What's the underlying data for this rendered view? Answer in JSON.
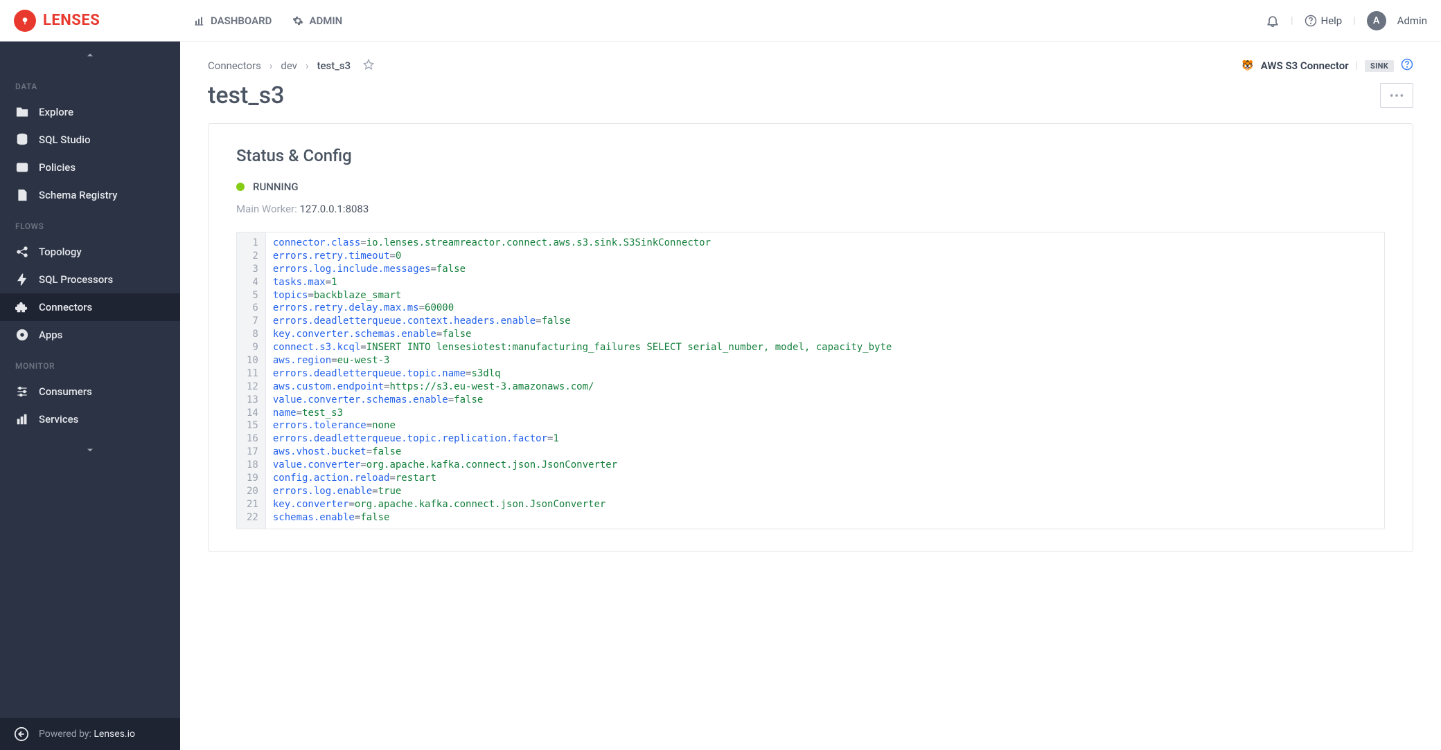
{
  "brand": {
    "name": "LENSES"
  },
  "topnav": {
    "dashboard": "DASHBOARD",
    "admin": "ADMIN"
  },
  "topbar": {
    "help": "Help",
    "user_initial": "A",
    "user_name": "Admin"
  },
  "sidebar": {
    "sections": [
      {
        "title": "DATA",
        "items": [
          {
            "id": "explore",
            "label": "Explore",
            "icon": "folder"
          },
          {
            "id": "sql-studio",
            "label": "SQL Studio",
            "icon": "database"
          },
          {
            "id": "policies",
            "label": "Policies",
            "icon": "id-card"
          },
          {
            "id": "schema-registry",
            "label": "Schema Registry",
            "icon": "file-text"
          }
        ]
      },
      {
        "title": "FLOWS",
        "items": [
          {
            "id": "topology",
            "label": "Topology",
            "icon": "share"
          },
          {
            "id": "sql-processors",
            "label": "SQL Processors",
            "icon": "bolt"
          },
          {
            "id": "connectors",
            "label": "Connectors",
            "icon": "puzzle",
            "active": true
          },
          {
            "id": "apps",
            "label": "Apps",
            "icon": "record"
          }
        ]
      },
      {
        "title": "MONITOR",
        "items": [
          {
            "id": "consumers",
            "label": "Consumers",
            "icon": "sliders"
          },
          {
            "id": "services",
            "label": "Services",
            "icon": "chart"
          }
        ]
      }
    ],
    "footer": {
      "prefix": "Powered by: ",
      "link": "Lenses.io"
    }
  },
  "breadcrumb": {
    "items": [
      "Connectors",
      "dev",
      "test_s3"
    ]
  },
  "connector_info": {
    "name": "AWS S3 Connector",
    "badge": "SINK"
  },
  "page": {
    "title": "test_s3",
    "section_title": "Status & Config",
    "status": "RUNNING",
    "worker_label": "Main Worker",
    "worker_value": "127.0.0.1:8083"
  },
  "config": [
    {
      "key": "connector.class",
      "value": "io.lenses.streamreactor.connect.aws.s3.sink.S3SinkConnector"
    },
    {
      "key": "errors.retry.timeout",
      "value": "0"
    },
    {
      "key": "errors.log.include.messages",
      "value": "false"
    },
    {
      "key": "tasks.max",
      "value": "1"
    },
    {
      "key": "topics",
      "value": "backblaze_smart"
    },
    {
      "key": "errors.retry.delay.max.ms",
      "value": "60000"
    },
    {
      "key": "errors.deadletterqueue.context.headers.enable",
      "value": "false"
    },
    {
      "key": "key.converter.schemas.enable",
      "value": "false"
    },
    {
      "key": "connect.s3.kcql",
      "value": "INSERT INTO lensesiotest:manufacturing_failures SELECT serial_number, model, capacity_byte"
    },
    {
      "key": "aws.region",
      "value": "eu-west-3"
    },
    {
      "key": "errors.deadletterqueue.topic.name",
      "value": "s3dlq"
    },
    {
      "key": "aws.custom.endpoint",
      "value": "https://s3.eu-west-3.amazonaws.com/"
    },
    {
      "key": "value.converter.schemas.enable",
      "value": "false"
    },
    {
      "key": "name",
      "value": "test_s3"
    },
    {
      "key": "errors.tolerance",
      "value": "none"
    },
    {
      "key": "errors.deadletterqueue.topic.replication.factor",
      "value": "1"
    },
    {
      "key": "aws.vhost.bucket",
      "value": "false"
    },
    {
      "key": "value.converter",
      "value": "org.apache.kafka.connect.json.JsonConverter"
    },
    {
      "key": "config.action.reload",
      "value": "restart"
    },
    {
      "key": "errors.log.enable",
      "value": "true"
    },
    {
      "key": "key.converter",
      "value": "org.apache.kafka.connect.json.JsonConverter"
    },
    {
      "key": "schemas.enable",
      "value": "false"
    }
  ]
}
